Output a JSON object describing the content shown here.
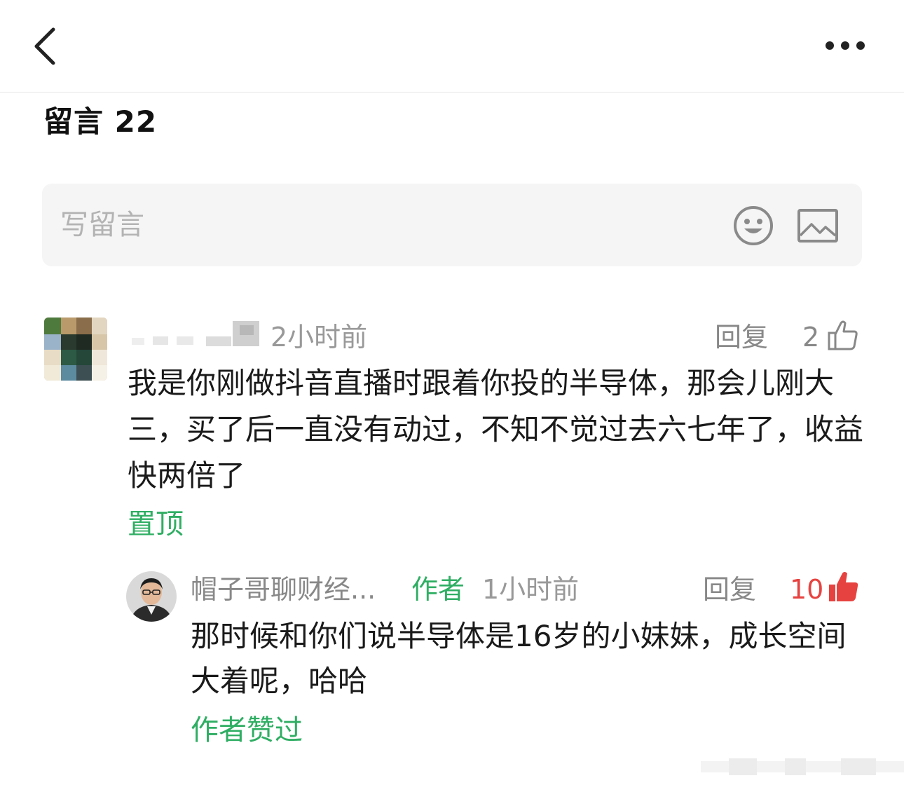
{
  "header": {
    "back_icon": "chevron-left-icon",
    "more_icon": "more-horizontal-icon"
  },
  "comments_section": {
    "title": "留言 22"
  },
  "compose": {
    "placeholder": "写留言",
    "emoji_icon": "smiley-icon",
    "image_icon": "image-icon"
  },
  "comment": {
    "time": "2小时前",
    "reply_label": "回复",
    "likes": "2",
    "text": "我是你刚做抖音直播时跟着你投的半导体，那会儿刚大三，买了后一直没有动过，不知不觉过去六七年了，收益快两倍了",
    "pin_label": "置顶"
  },
  "author_reply": {
    "name": "帽子哥聊财经...",
    "author_badge": "作者",
    "time": "1小时前",
    "reply_label": "回复",
    "likes": "10",
    "text": "那时候和你们说半导体是16岁的小妹妹，成长空间大着呢，哈哈",
    "author_liked_label": "作者赞过"
  },
  "colors": {
    "accent_green": "#2fae63",
    "like_red": "#e64340",
    "muted_gray": "#999999",
    "compose_bg": "#f5f5f5"
  }
}
